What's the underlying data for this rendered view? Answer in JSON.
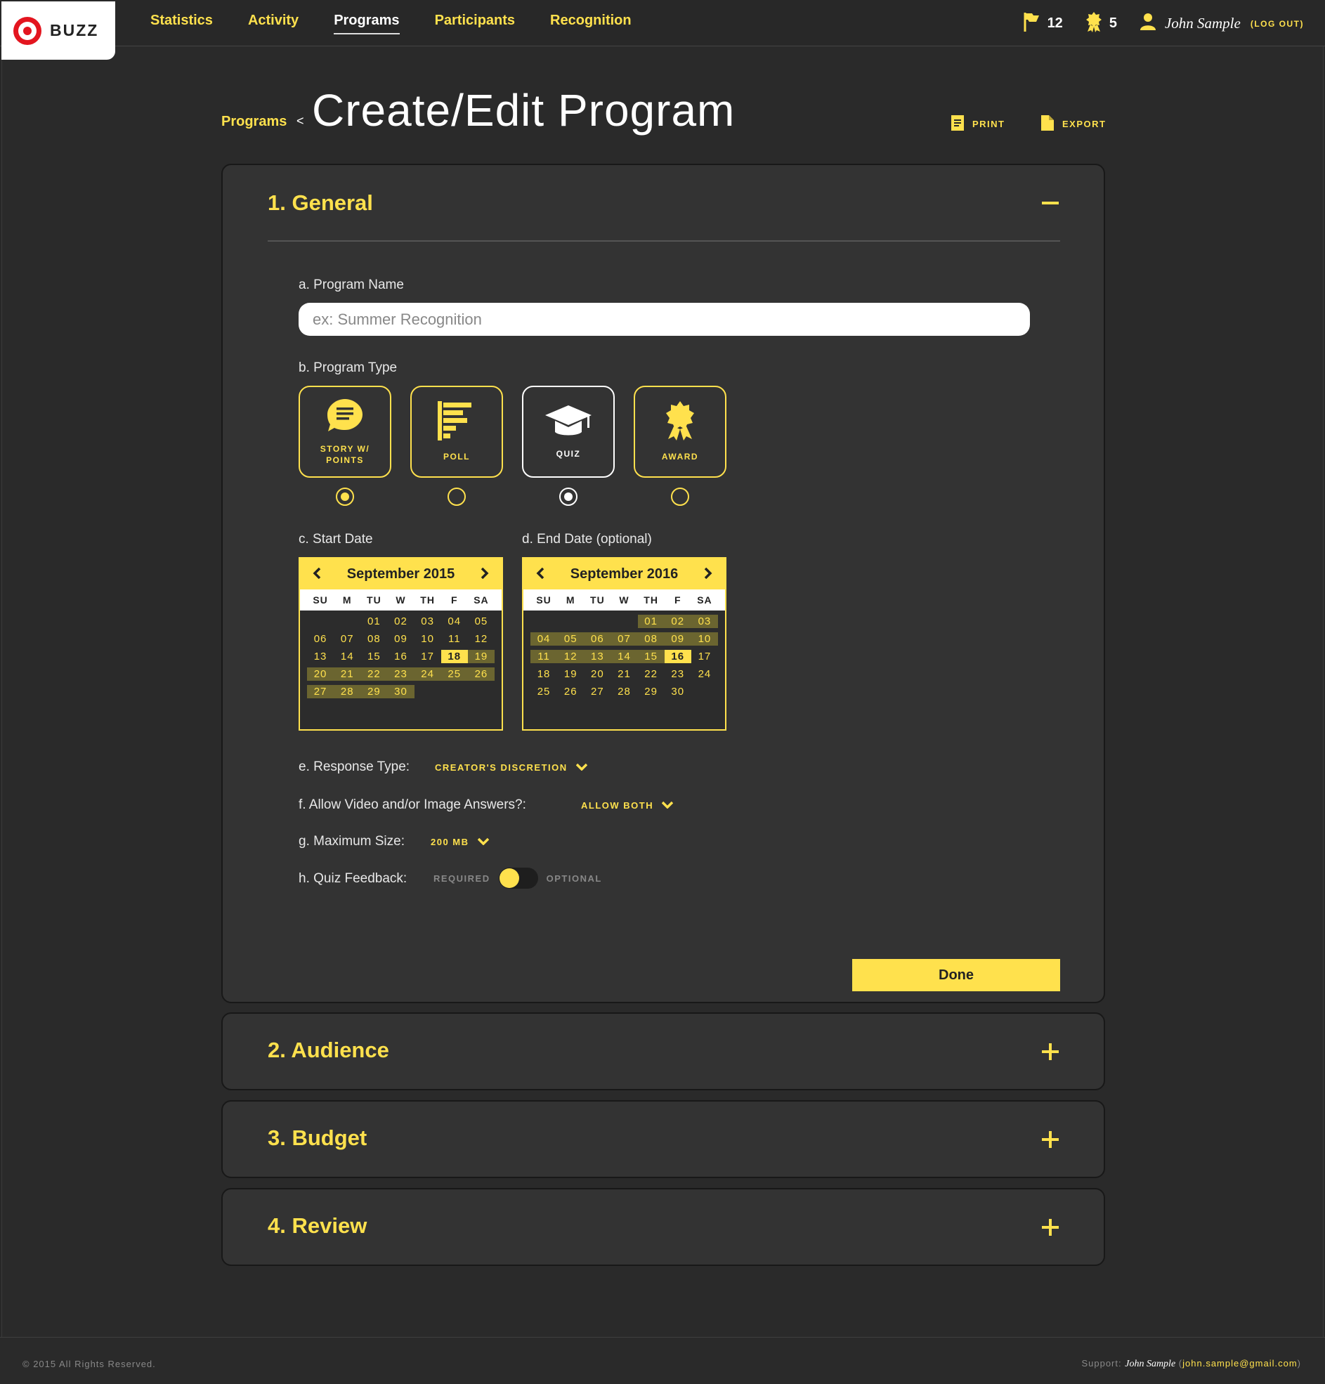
{
  "app": {
    "name": "BUZZ"
  },
  "nav": {
    "items": [
      {
        "label": "Statistics"
      },
      {
        "label": "Activity"
      },
      {
        "label": "Programs"
      },
      {
        "label": "Participants"
      },
      {
        "label": "Recognition"
      }
    ],
    "active": "Programs"
  },
  "header_right": {
    "flags_count": "12",
    "awards_count": "5",
    "user_name": "John Sample",
    "logout_label": "(LOG OUT)"
  },
  "page": {
    "breadcrumb": "Programs",
    "breadcrumb_sep": "<",
    "title": "Create/Edit Program",
    "print_label": "PRINT",
    "export_label": "EXPORT"
  },
  "sections": [
    {
      "title": "1. General",
      "expanded": true
    },
    {
      "title": "2. Audience",
      "expanded": false
    },
    {
      "title": "3. Budget",
      "expanded": false
    },
    {
      "title": "4. Review",
      "expanded": false
    }
  ],
  "general": {
    "program_name_label": "a. Program Name",
    "program_name_placeholder": "ex: Summer Recognition",
    "program_name_value": "",
    "program_type_label": "b. Program Type",
    "program_types": [
      {
        "label_line1": "STORY W/",
        "label_line2": "POINTS",
        "icon": "speech-bubble-icon",
        "checked": true
      },
      {
        "label_line1": "POLL",
        "label_line2": "",
        "icon": "bar-chart-icon",
        "checked": false
      },
      {
        "label_line1": "QUIZ",
        "label_line2": "",
        "icon": "graduation-cap-icon",
        "checked": true
      },
      {
        "label_line1": "AWARD",
        "label_line2": "",
        "icon": "award-ribbon-icon",
        "checked": false
      }
    ],
    "start_date_label": "c. Start Date",
    "end_date_label": "d. End Date (optional)",
    "start_calendar": {
      "month_label": "September 2015",
      "selected_day": "18",
      "days": [
        "",
        "",
        "01",
        "02",
        "03",
        "04",
        "05",
        "06",
        "07",
        "08",
        "09",
        "10",
        "11",
        "12",
        "13",
        "14",
        "15",
        "16",
        "17",
        "18",
        "19",
        "20",
        "21",
        "22",
        "23",
        "24",
        "25",
        "26",
        "27",
        "28",
        "29",
        "30"
      ]
    },
    "end_calendar": {
      "month_label": "September 2016",
      "selected_day": "16",
      "days": [
        "",
        "",
        "",
        "",
        "01",
        "02",
        "03",
        "04",
        "05",
        "06",
        "07",
        "08",
        "09",
        "10",
        "11",
        "12",
        "13",
        "14",
        "15",
        "16",
        "17",
        "18",
        "19",
        "20",
        "21",
        "22",
        "23",
        "24",
        "25",
        "26",
        "27",
        "28",
        "29",
        "30"
      ]
    },
    "weekdays": [
      "SU",
      "M",
      "TU",
      "W",
      "TH",
      "F",
      "SA"
    ],
    "response_type_label": "e. Response Type:",
    "response_type_value": "CREATOR'S DISCRETION",
    "allow_media_label": "f. Allow Video and/or Image Answers?:",
    "allow_media_value": "ALLOW BOTH",
    "max_size_label": "g. Maximum Size:",
    "max_size_value": "200 MB",
    "quiz_feedback_label": "h. Quiz Feedback:",
    "quiz_feedback_left": "REQUIRED",
    "quiz_feedback_right": "OPTIONAL",
    "quiz_feedback_value": "REQUIRED",
    "done_label": "Done"
  },
  "footer": {
    "copyright": "© 2015 All Rights Reserved.",
    "support_label": "Support:",
    "support_name": "John Sample",
    "support_email": "john.sample@gmail.com"
  },
  "colors": {
    "accent": "#ffe14d",
    "background": "#282828",
    "panel": "#333333",
    "brand_red": "#e3151f"
  }
}
